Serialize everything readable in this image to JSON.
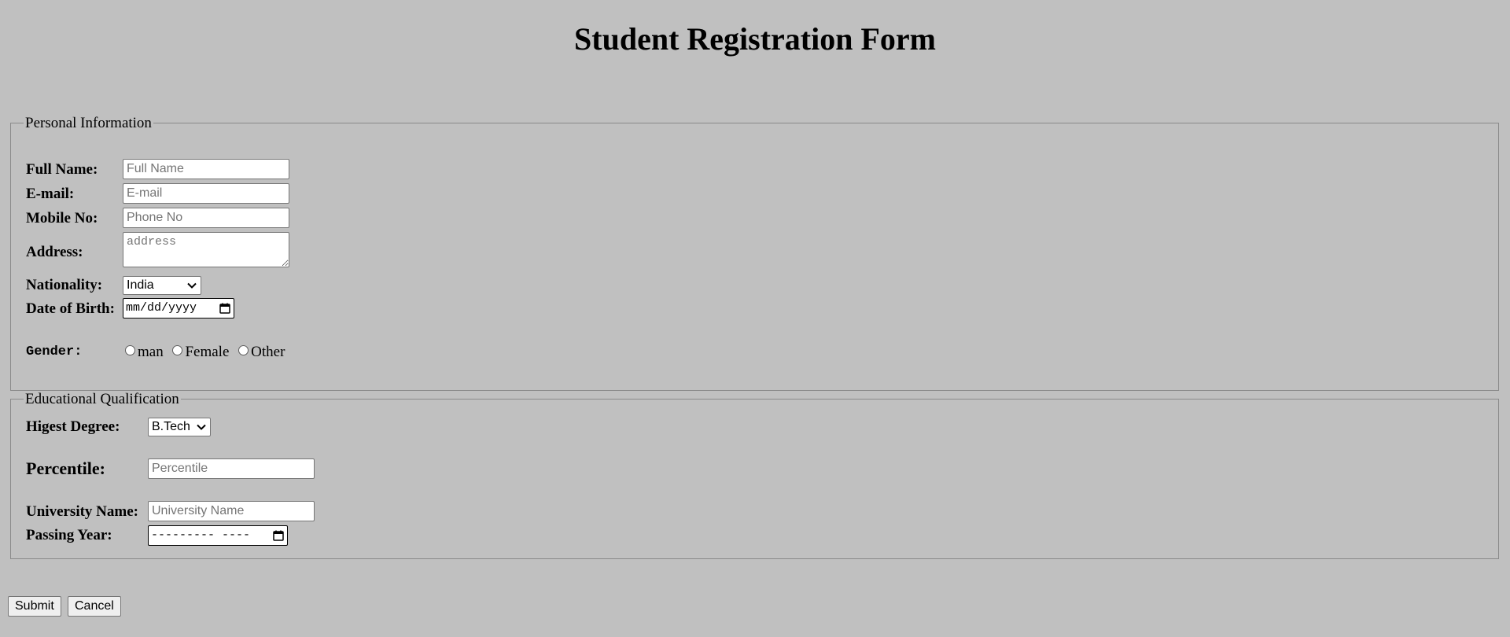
{
  "page": {
    "title": "Student Registration Form"
  },
  "personal": {
    "legend": "Personal Information",
    "full_name": {
      "label": "Full Name:",
      "placeholder": "Full Name",
      "value": ""
    },
    "email": {
      "label": "E-mail:",
      "placeholder": "E-mail",
      "value": ""
    },
    "mobile": {
      "label": "Mobile No:",
      "placeholder": "Phone No",
      "value": ""
    },
    "address": {
      "label": "Address:",
      "placeholder": "address",
      "value": ""
    },
    "nationality": {
      "label": "Nationality:",
      "selected": "India"
    },
    "dob": {
      "label": "Date of Birth:",
      "placeholder": "mm/dd/yyyy"
    },
    "gender": {
      "label": "Gender:",
      "options": [
        "man",
        "Female",
        "Other"
      ]
    }
  },
  "education": {
    "legend": "Educational Qualification",
    "degree": {
      "label": "Higest Degree:",
      "selected": "B.Tech"
    },
    "percentile": {
      "label": "Percentile:",
      "placeholder": "Percentile",
      "value": ""
    },
    "university": {
      "label": "University Name:",
      "placeholder": "University Name",
      "value": ""
    },
    "passing_year": {
      "label": "Passing Year:",
      "placeholder": "--------- ----"
    }
  },
  "actions": {
    "submit_label": "Submit",
    "cancel_label": "Cancel"
  }
}
